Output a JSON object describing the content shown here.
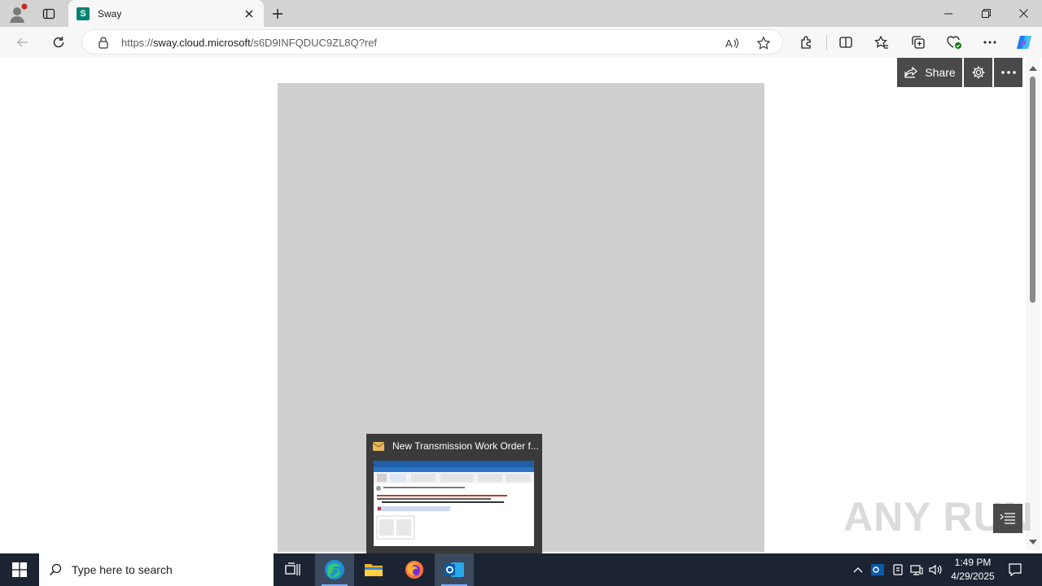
{
  "browser": {
    "tab_title": "Sway",
    "tab_favicon_letter": "S",
    "url_prefix": "https://",
    "url_host": "sway.cloud.microsoft",
    "url_path": "/s6D9INFQDUC9ZL8Q?ref",
    "icons": [
      "profile-icon",
      "tab-actions-icon",
      "close-icon",
      "new-tab-icon",
      "minimize-icon",
      "restore-icon",
      "window-close-icon",
      "back-icon",
      "refresh-icon",
      "lock-icon",
      "read-aloud-icon",
      "favorite-star-icon",
      "extensions-icon",
      "split-screen-icon",
      "favorites-icon",
      "collections-icon",
      "browser-essentials-icon",
      "more-icon",
      "copilot-icon"
    ]
  },
  "sway": {
    "share_label": "Share",
    "doc_background": "#cfcfcf"
  },
  "watermark": {
    "text": "ANY RUN"
  },
  "preview": {
    "title": "New Transmission Work Order f..."
  },
  "taskbar": {
    "search_placeholder": "Type here to search",
    "time": "1:49 PM",
    "date": "4/29/2025",
    "apps": [
      "task-view",
      "edge",
      "file-explorer",
      "firefox",
      "outlook"
    ]
  },
  "colors": {
    "taskbar": "#1c2433",
    "sway_accent": "#008272",
    "action_bar": "#4a4a4a"
  }
}
